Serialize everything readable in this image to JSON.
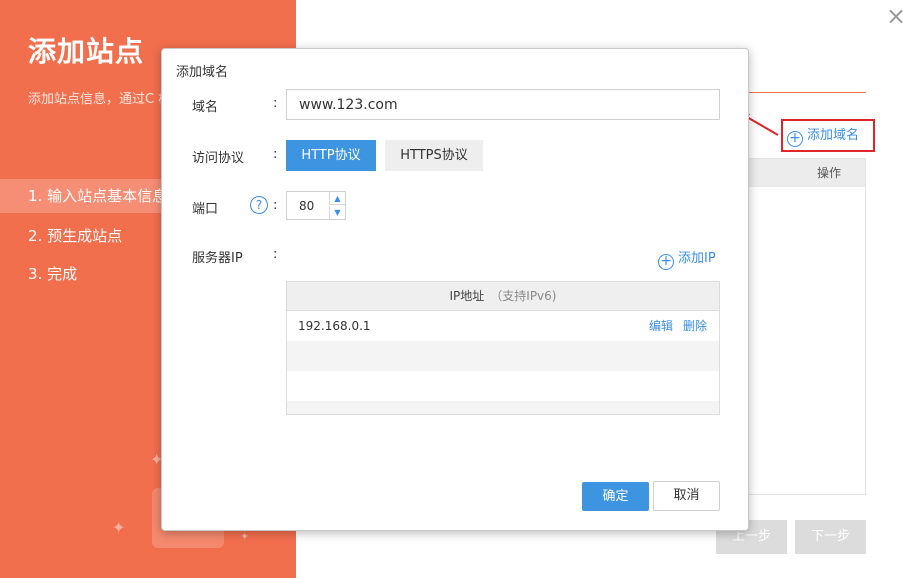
{
  "sidebar": {
    "title": "添加站点",
    "description": "添加站点信息，通过C 松实现站点防护",
    "steps": [
      "1. 输入站点基本信息",
      "2. 预生成站点",
      "3. 完成"
    ]
  },
  "background": {
    "add_domain_label": "添加域名",
    "table_header": "操作",
    "prev_label": "上一步",
    "next_label": "下一步"
  },
  "dialog": {
    "title": "添加域名",
    "domain_label": "域名",
    "domain_value": "www.123.com",
    "protocol_label": "访问协议",
    "protocol_options": [
      "HTTP协议",
      "HTTPS协议"
    ],
    "protocol_selected": "HTTP协议",
    "port_label": "端口",
    "port_value": "80",
    "server_ip_label": "服务器IP",
    "add_ip_label": "添加IP",
    "ip_table": {
      "header": "IP地址",
      "header_note": "（支持IPv6)",
      "rows": [
        {
          "ip": "192.168.0.1",
          "edit": "编辑",
          "delete": "删除"
        }
      ]
    },
    "confirm_label": "确定",
    "cancel_label": "取消"
  },
  "colors": {
    "sidebar_bg": "#f26f4e",
    "primary_blue": "#3d95e2",
    "highlight_red": "#e0262b"
  }
}
